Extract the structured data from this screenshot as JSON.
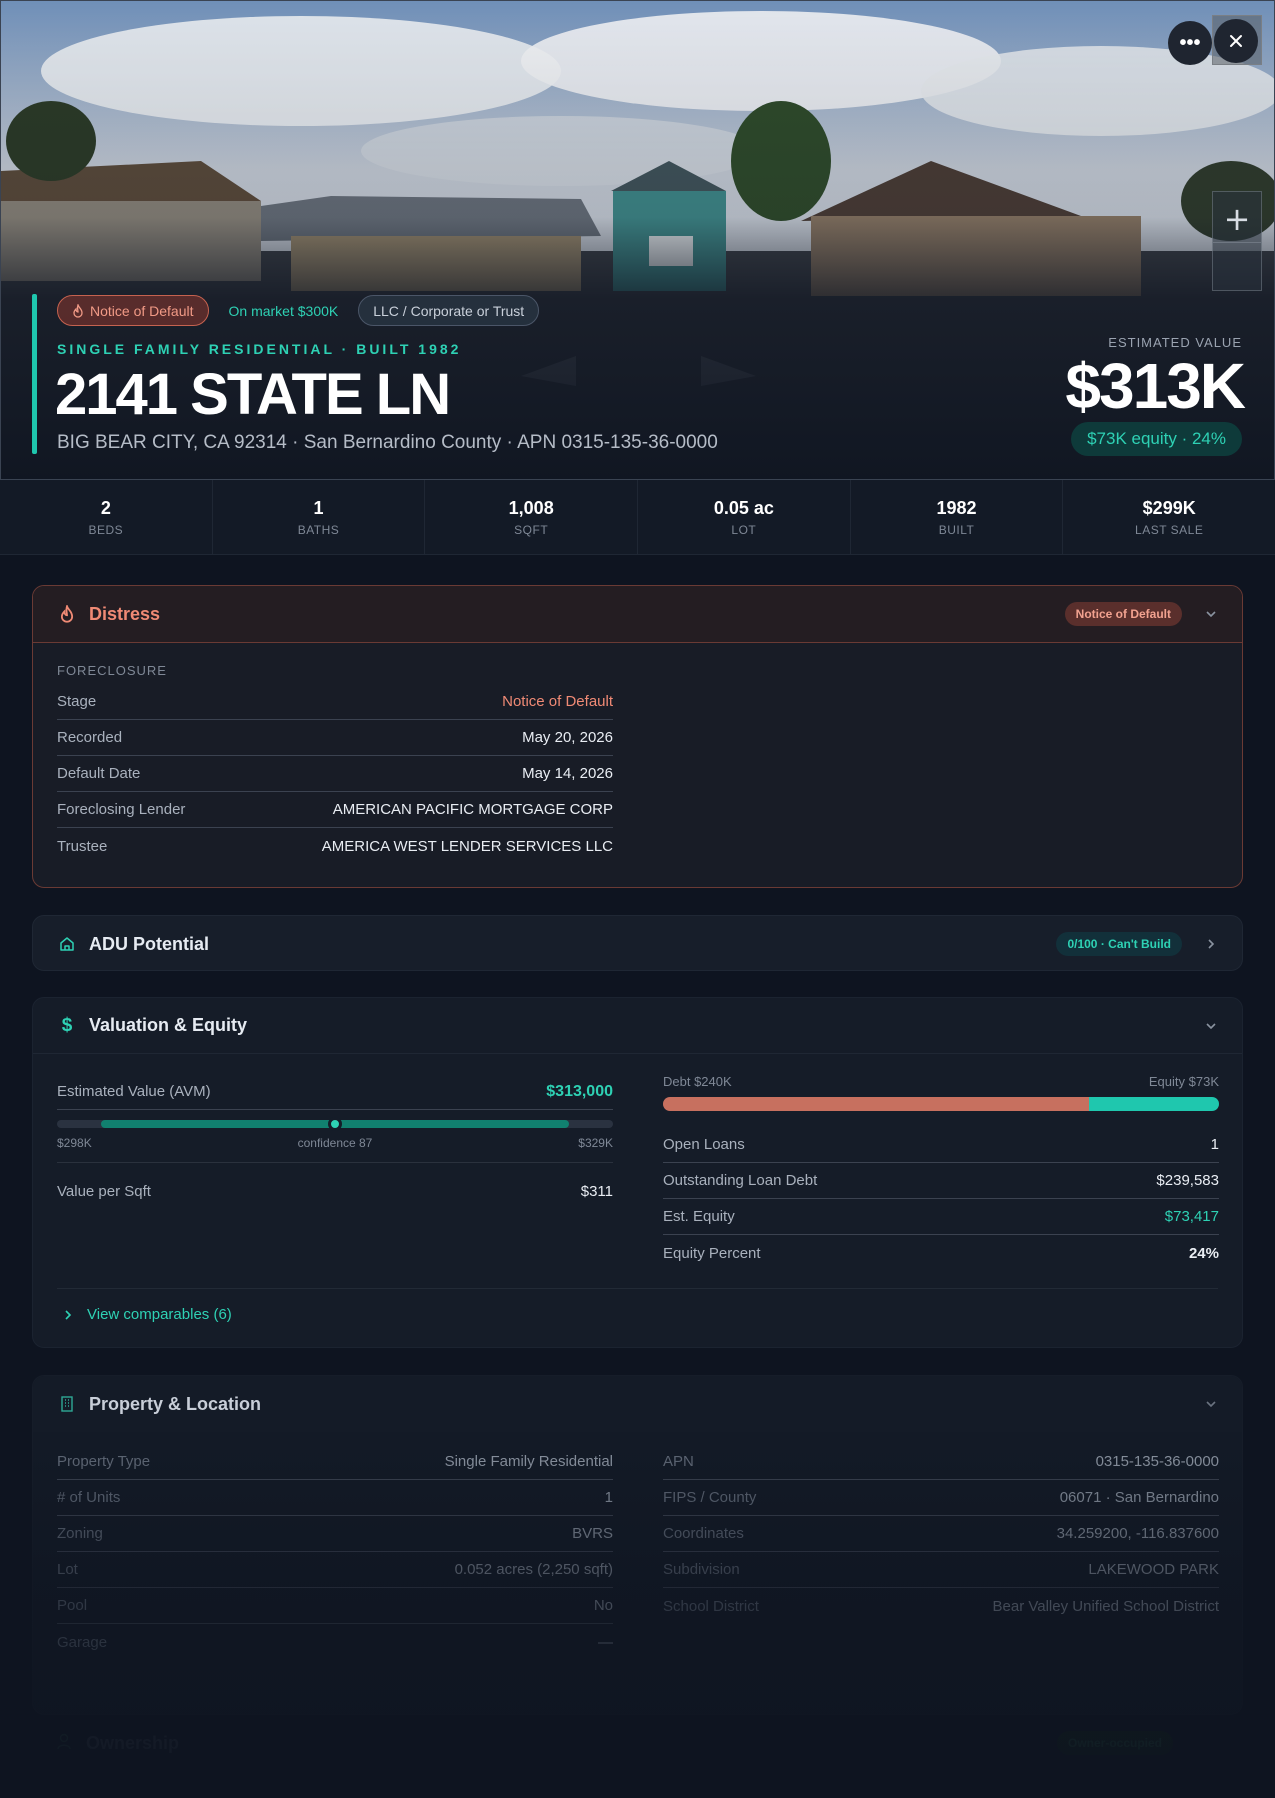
{
  "hero": {
    "chips": [
      "Notice of Default",
      "On market $300K",
      "LLC / Corporate or Trust"
    ],
    "subtitle": "SINGLE FAMILY RESIDENTIAL · BUILT 1982",
    "title": "2141 STATE LN",
    "address": "BIG BEAR CITY, CA 92314 · San Bernardino County · APN 0315-135-36-0000",
    "estimated_label": "ESTIMATED VALUE",
    "estimated_value": "$313K",
    "equity_pill": "$73K equity · 24%"
  },
  "stats": [
    {
      "value": "2",
      "label": "BEDS"
    },
    {
      "value": "1",
      "label": "BATHS"
    },
    {
      "value": "1,008",
      "label": "SQFT"
    },
    {
      "value": "0.05 ac",
      "label": "LOT"
    },
    {
      "value": "1982",
      "label": "BUILT"
    },
    {
      "value": "$299K",
      "label": "LAST SALE"
    }
  ],
  "distress": {
    "title": "Distress",
    "badge": "Notice of Default",
    "section": "FORECLOSURE",
    "rows": [
      {
        "k": "Stage",
        "v": "Notice of Default"
      },
      {
        "k": "Recorded",
        "v": "May 20, 2026"
      },
      {
        "k": "Default Date",
        "v": "May 14, 2026"
      },
      {
        "k": "Foreclosing Lender",
        "v": "AMERICAN PACIFIC MORTGAGE CORP"
      },
      {
        "k": "Trustee",
        "v": "AMERICA WEST LENDER SERVICES LLC"
      }
    ]
  },
  "adu": {
    "title": "ADU Potential",
    "badge": "0/100 · Can't Build"
  },
  "valuation": {
    "title": "Valuation & Equity",
    "avm_label": "Estimated Value (AVM)",
    "avm_value": "$313,000",
    "range_low": "$298K",
    "confidence": "confidence 87",
    "range_high": "$329K",
    "range_fill_start": 0.08,
    "range_fill_end": 0.92,
    "avm_position": 0.5,
    "value_per_sqft_label": "Value per Sqft",
    "value_per_sqft": "$311",
    "debt_label": "Debt $240K",
    "equity_label": "Equity $73K",
    "debt_fraction": 0.766,
    "debt_color": "#c7705f",
    "equity_color": "#1fc7ae",
    "rows": [
      {
        "k": "Open Loans",
        "v": "1"
      },
      {
        "k": "Outstanding Loan Debt",
        "v": "$239,583"
      },
      {
        "k": "Est. Equity",
        "v": "$73,417"
      },
      {
        "k": "Equity Percent",
        "v": "24%"
      }
    ],
    "comps_link": "View comparables (6)"
  },
  "property": {
    "title": "Property & Location",
    "left": [
      {
        "k": "Property Type",
        "v": "Single Family Residential"
      },
      {
        "k": "# of Units",
        "v": "1"
      },
      {
        "k": "Zoning",
        "v": "BVRS"
      },
      {
        "k": "Lot",
        "v": "0.052 acres (2,250 sqft)"
      },
      {
        "k": "Pool",
        "v": "No"
      },
      {
        "k": "Garage",
        "v": "—"
      }
    ],
    "right": [
      {
        "k": "APN",
        "v": "0315-135-36-0000"
      },
      {
        "k": "FIPS / County",
        "v": "06071 · San Bernardino"
      },
      {
        "k": "Coordinates",
        "v": "34.259200, -116.837600"
      },
      {
        "k": "Subdivision",
        "v": "LAKEWOOD PARK"
      },
      {
        "k": "School District",
        "v": "Bear Valley Unified School District"
      }
    ]
  },
  "ownership": {
    "title": "Ownership",
    "badge": "Owner-occupied"
  },
  "colors": {
    "accent": "#1fc7ae",
    "distress": "#f08a75"
  }
}
